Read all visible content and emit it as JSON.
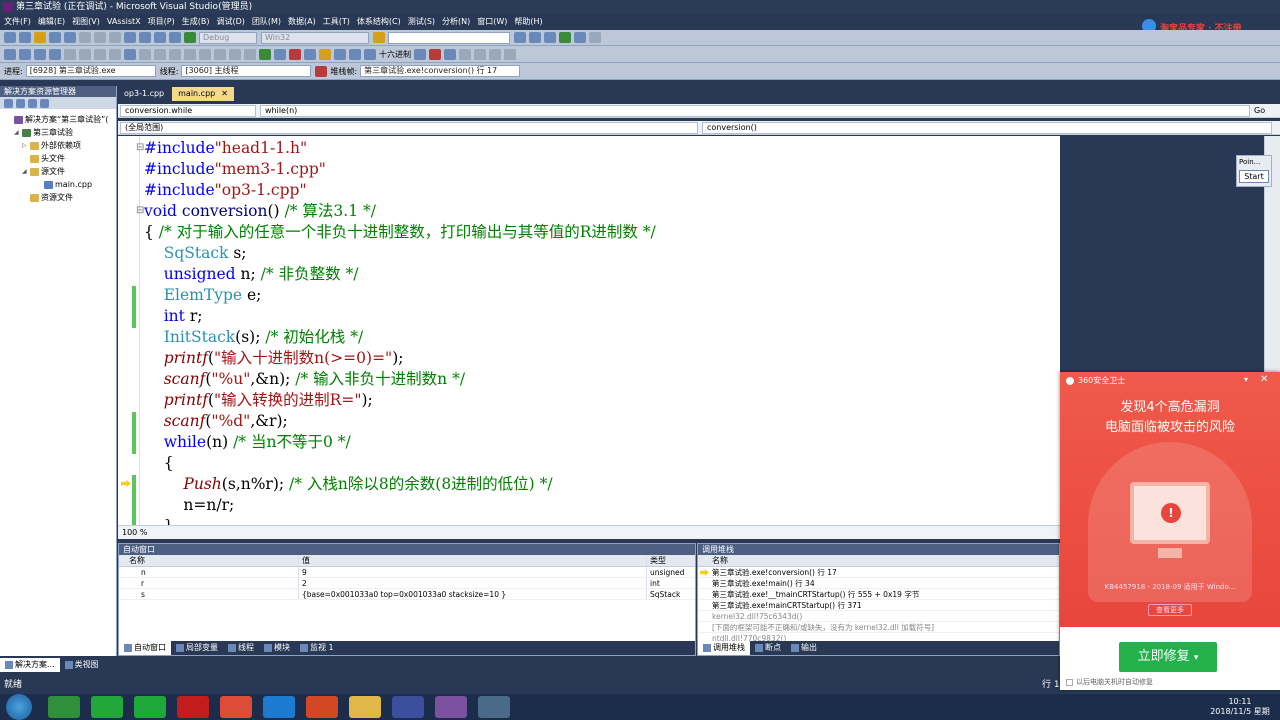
{
  "window": {
    "title": "第三章试验 (正在调试) - Microsoft Visual Studio(管理员)"
  },
  "menu": [
    "文件(F)",
    "编辑(E)",
    "视图(V)",
    "VAssistX",
    "项目(P)",
    "生成(B)",
    "调试(D)",
    "团队(M)",
    "数据(A)",
    "工具(T)",
    "体系结构(C)",
    "测试(S)",
    "分析(N)",
    "窗口(W)",
    "帮助(H)"
  ],
  "toolbar": {
    "config": "Debug",
    "platform": "Win32",
    "hex_label": "十六进制",
    "process_label": "进程:",
    "process_value": "[6928] 第三章试验.exe",
    "thread_label": "线程:",
    "thread_value": "[3060] 主线程",
    "stack_label": "堆栈帧:",
    "stack_value": "第三章试验.exe!conversion() 行 17"
  },
  "solution_explorer": {
    "title": "解决方案资源管理器",
    "items": [
      {
        "label": "解决方案“第三章试验”(",
        "level": 0,
        "icon": "solution-icon",
        "expand": ""
      },
      {
        "label": "第三章试验",
        "level": 1,
        "icon": "project-icon",
        "expand": "◢"
      },
      {
        "label": "外部依赖项",
        "level": 2,
        "icon": "folder-icon",
        "expand": "▷"
      },
      {
        "label": "头文件",
        "level": 2,
        "icon": "folder-icon",
        "expand": ""
      },
      {
        "label": "源文件",
        "level": 2,
        "icon": "folder-icon",
        "expand": "◢"
      },
      {
        "label": "main.cpp",
        "level": 3,
        "icon": "cpp-file-icon",
        "expand": ""
      },
      {
        "label": "资源文件",
        "level": 2,
        "icon": "folder-icon",
        "expand": ""
      }
    ],
    "bottom_tabs": [
      "解决方案...",
      "类视图"
    ]
  },
  "doc_tabs": [
    {
      "label": "op3-1.cpp",
      "active": false
    },
    {
      "label": "main.cpp",
      "active": true
    }
  ],
  "nav": {
    "left": "conversion.while",
    "right": "while(n)",
    "scope": "(全局范围)",
    "member": "conversion()",
    "go": "Go"
  },
  "code": [
    "#include\"head1-1.h\"",
    "#include\"mem3-1.cpp\"",
    "#include\"op3-1.cpp\"",
    "void conversion() /* 算法3.1 */",
    "{ /* 对于输入的任意一个非负十进制整数，打印输出与其等值的R进制数 */",
    "    SqStack s;",
    "    unsigned n; /* 非负整数 */",
    "    ElemType e;",
    "    int r;",
    "    InitStack(s); /* 初始化栈 */",
    "    printf(\"输入十进制数n(>=0)=\");",
    "    scanf(\"%u\",&n); /* 输入非负十进制数n */",
    "    printf(\"输入转换的进制R=\");",
    "    scanf(\"%d\",&r);",
    "    while(n) /* 当n不等于0 */",
    "    {",
    "        Push(s,n%r); /* 入栈n除以8的余数(8进制的低位) */",
    "        n=n/r;",
    "    }"
  ],
  "zoom": "100 %",
  "autos": {
    "title": "自动窗口",
    "headers": [
      "名称",
      "值",
      "类型"
    ],
    "rows": [
      {
        "name": "n",
        "value": "9",
        "type": "unsigned"
      },
      {
        "name": "r",
        "value": "2",
        "type": "int"
      },
      {
        "name": "s",
        "value": "{base=0x001033a0 top=0x001033a0 stacksize=10 }",
        "type": "SqStack"
      }
    ],
    "bottom_tabs": [
      "自动窗口",
      "局部变量",
      "线程",
      "模块",
      "监视 1"
    ]
  },
  "callstack": {
    "title": "调用堆栈",
    "header": "名称",
    "rows": [
      {
        "text": "第三章试验.exe!conversion()  行 17",
        "gray": false
      },
      {
        "text": "第三章试验.exe!main()  行 34",
        "gray": false
      },
      {
        "text": "第三章试验.exe!__tmainCRTStartup()  行 555 + 0x19 字节",
        "gray": false
      },
      {
        "text": "第三章试验.exe!mainCRTStartup()  行 371",
        "gray": false
      },
      {
        "text": "kernel32.dll!75c6343d()",
        "gray": true
      },
      {
        "text": "[下面的框架可能不正确和/或缺失，没有为 kernel32.dll 加载符号]",
        "gray": true
      },
      {
        "text": "ntdll.dll!770c9832()",
        "gray": true
      }
    ],
    "bottom_tabs": [
      "调用堆栈",
      "断点",
      "输出"
    ]
  },
  "status": {
    "left": "就绪",
    "right": "行 1"
  },
  "points": {
    "title": "Poin...",
    "start": "Start"
  },
  "popup": {
    "brand": "360安全卫士",
    "line1": "发现4个高危漏洞",
    "line2": "电脑面临被攻击的风险",
    "kb": "KB4457918 - 2018-09 适用于 Windo...",
    "more": "查看更多",
    "button": "立即修复",
    "checkbox": "以后电脑关机时自动修复"
  },
  "ad_text": "淘宝品专家 · 不注册",
  "clock": {
    "time": "10:11",
    "date": "2018/11/5 星期一"
  }
}
